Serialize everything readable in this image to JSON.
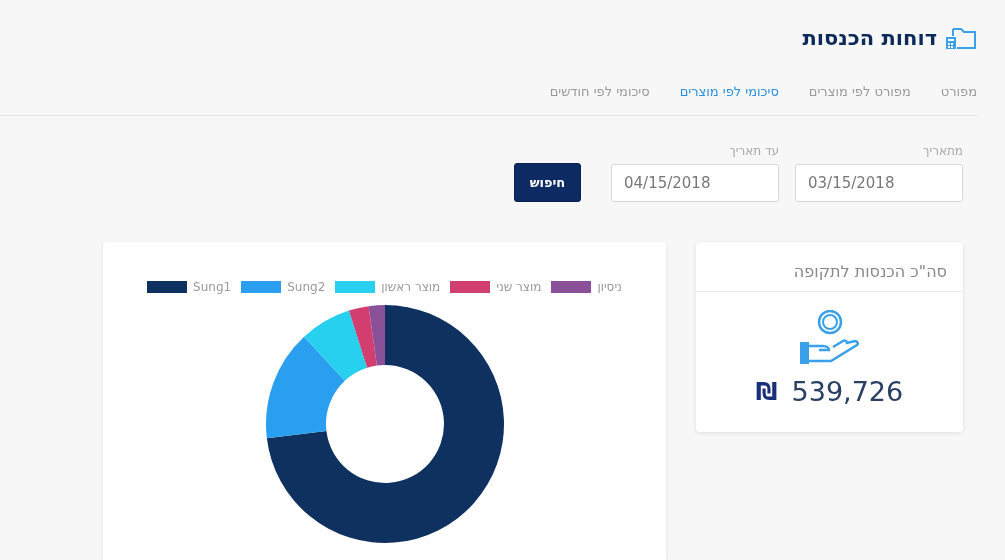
{
  "header": {
    "title": "דוחות הכנסות"
  },
  "tabs": [
    {
      "label": "מפורט",
      "selected": false
    },
    {
      "label": "מפורט לפי מוצרים",
      "selected": false
    },
    {
      "label": "סיכומי לפי מוצרים",
      "selected": true
    },
    {
      "label": "סיכומי לפי חודשים",
      "selected": false
    }
  ],
  "filters": {
    "from": {
      "label": "מתאריך",
      "value": "03/15/2018"
    },
    "to": {
      "label": "עד תאריך",
      "value": "04/15/2018"
    },
    "search_button": "חיפוש"
  },
  "total_card": {
    "title": "סה\"כ הכנסות לתקופה",
    "currency": "₪",
    "amount": "539,726"
  },
  "chart_legend": [
    {
      "name": "ניסיון",
      "color": "#8a5098"
    },
    {
      "name": "מוצר שני",
      "color": "#d33e70"
    },
    {
      "name": "מוצר ראשון",
      "color": "#26d0ee"
    },
    {
      "name": "Sung2",
      "color": "#2a9ff0"
    },
    {
      "name": "Sung1",
      "color": "#0f3160"
    }
  ]
}
